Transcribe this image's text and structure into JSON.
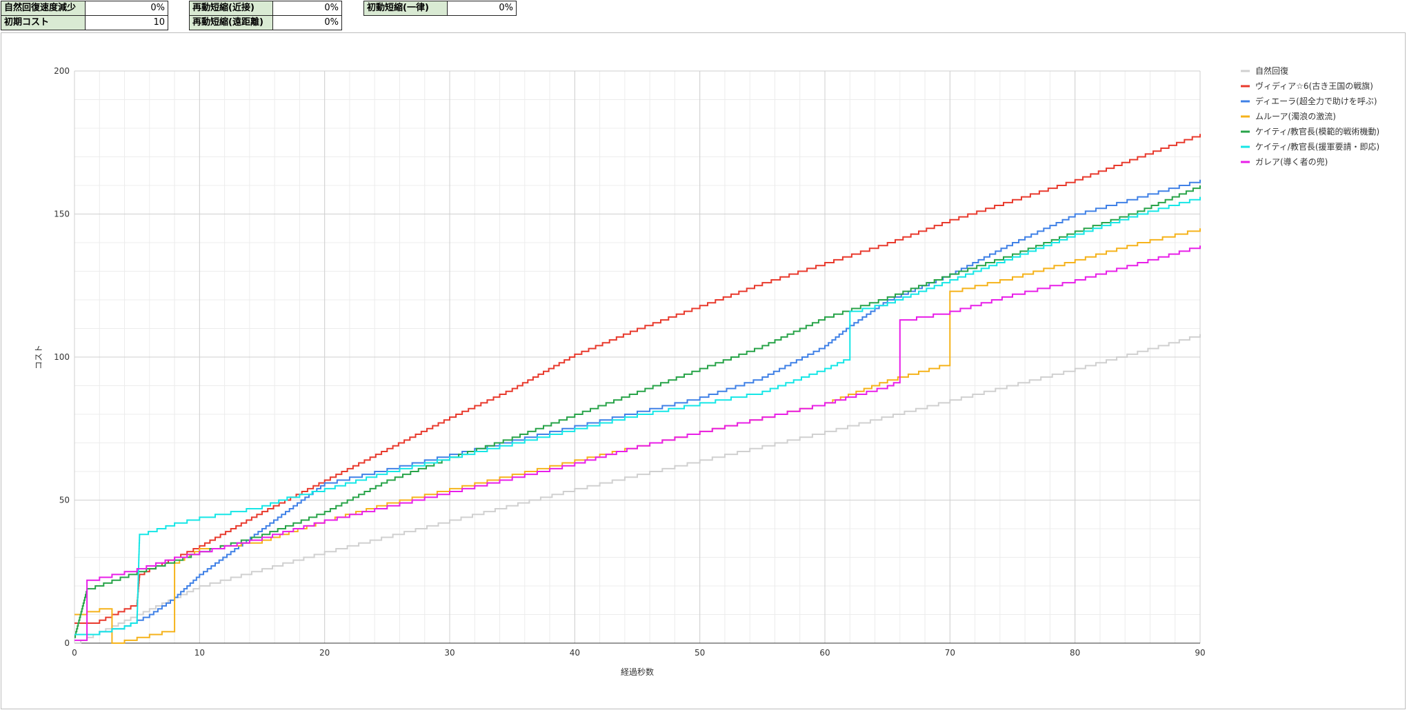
{
  "settings": {
    "regen_decrease_label": "自然回復速度減少",
    "regen_decrease_value": "0%",
    "initial_cost_label": "初期コスト",
    "initial_cost_value": "10",
    "redeploy_melee_label": "再動短縮(近接)",
    "redeploy_melee_value": "0%",
    "redeploy_ranged_label": "再動短縮(遠距離)",
    "redeploy_ranged_value": "0%",
    "initial_uniform_label": "初動短縮(一律)",
    "initial_uniform_value": "0%"
  },
  "chart_data": {
    "type": "line",
    "title": "",
    "xlabel": "経過秒数",
    "ylabel": "コスト",
    "xlim": [
      0,
      90
    ],
    "ylim": [
      0,
      200
    ],
    "xticks": [
      "0",
      "10",
      "20",
      "30",
      "40",
      "50",
      "60",
      "70",
      "80",
      "90"
    ],
    "yticks": [
      "0",
      "50",
      "100",
      "150",
      "200"
    ],
    "grid": true,
    "legend_position": "right",
    "series": [
      {
        "name": "自然回復",
        "color": "#d0d0d0",
        "points": [
          [
            0,
            0
          ],
          [
            10,
            20
          ],
          [
            20,
            32
          ],
          [
            30,
            43
          ],
          [
            40,
            54
          ],
          [
            50,
            64
          ],
          [
            60,
            74
          ],
          [
            70,
            85
          ],
          [
            80,
            96
          ],
          [
            90,
            108
          ]
        ]
      },
      {
        "name": "ヴィディア☆6(古き王国の戦旗)",
        "color": "#e8392c",
        "points": [
          [
            0,
            7
          ],
          [
            2,
            8
          ],
          [
            3,
            10
          ],
          [
            4,
            12
          ],
          [
            5,
            14
          ],
          [
            5.2,
            24
          ],
          [
            6,
            26
          ],
          [
            8,
            30
          ],
          [
            10,
            34
          ],
          [
            15,
            46
          ],
          [
            20,
            57
          ],
          [
            25,
            68
          ],
          [
            30,
            79
          ],
          [
            35,
            89
          ],
          [
            40,
            101
          ],
          [
            45,
            110
          ],
          [
            50,
            118
          ],
          [
            55,
            126
          ],
          [
            60,
            133
          ],
          [
            65,
            140
          ],
          [
            70,
            148
          ],
          [
            75,
            155
          ],
          [
            80,
            162
          ],
          [
            85,
            170
          ],
          [
            90,
            178
          ]
        ]
      },
      {
        "name": "ディエーラ(超全力で助けを呼ぶ)",
        "color": "#3f80e6",
        "points": [
          [
            0,
            3
          ],
          [
            2,
            4
          ],
          [
            4,
            6
          ],
          [
            6,
            10
          ],
          [
            8,
            16
          ],
          [
            10,
            24
          ],
          [
            15,
            40
          ],
          [
            20,
            56
          ],
          [
            25,
            61
          ],
          [
            30,
            66
          ],
          [
            35,
            71
          ],
          [
            40,
            76
          ],
          [
            45,
            81
          ],
          [
            50,
            86
          ],
          [
            55,
            93
          ],
          [
            60,
            104
          ],
          [
            62,
            111
          ],
          [
            65,
            120
          ],
          [
            70,
            129
          ],
          [
            75,
            140
          ],
          [
            80,
            150
          ],
          [
            85,
            156
          ],
          [
            90,
            162
          ]
        ]
      },
      {
        "name": "ムルーア(濁浪の激流)",
        "color": "#f5b21a",
        "points": [
          [
            0,
            10
          ],
          [
            2,
            12
          ],
          [
            3,
            12
          ],
          [
            3,
            0
          ],
          [
            4,
            1
          ],
          [
            6,
            3
          ],
          [
            8,
            5
          ],
          [
            8,
            28
          ],
          [
            10,
            33
          ],
          [
            15,
            36
          ],
          [
            20,
            43
          ],
          [
            25,
            49
          ],
          [
            30,
            54
          ],
          [
            35,
            59
          ],
          [
            40,
            64
          ],
          [
            45,
            69
          ],
          [
            50,
            74
          ],
          [
            55,
            79
          ],
          [
            60,
            84
          ],
          [
            65,
            92
          ],
          [
            70,
            98
          ],
          [
            70,
            123
          ],
          [
            75,
            128
          ],
          [
            80,
            134
          ],
          [
            85,
            140
          ],
          [
            90,
            145
          ]
        ]
      },
      {
        "name": "ケイティ/教官長(模範的戦術機動)",
        "color": "#27a348",
        "points": [
          [
            0,
            2
          ],
          [
            1,
            19
          ],
          [
            3,
            22
          ],
          [
            5,
            25
          ],
          [
            8,
            29
          ],
          [
            10,
            32
          ],
          [
            15,
            38
          ],
          [
            20,
            46
          ],
          [
            25,
            57
          ],
          [
            30,
            65
          ],
          [
            35,
            72
          ],
          [
            40,
            80
          ],
          [
            45,
            88
          ],
          [
            50,
            96
          ],
          [
            55,
            104
          ],
          [
            60,
            114
          ],
          [
            65,
            121
          ],
          [
            70,
            129
          ],
          [
            75,
            136
          ],
          [
            80,
            144
          ],
          [
            85,
            151
          ],
          [
            90,
            160
          ]
        ]
      },
      {
        "name": "ケイティ/教官長(援軍要請・即応)",
        "color": "#15e6e6",
        "points": [
          [
            0,
            3
          ],
          [
            2,
            4
          ],
          [
            4,
            6
          ],
          [
            5,
            8
          ],
          [
            5.2,
            38
          ],
          [
            8,
            42
          ],
          [
            10,
            44
          ],
          [
            15,
            48
          ],
          [
            17,
            51
          ],
          [
            20,
            54
          ],
          [
            25,
            60
          ],
          [
            30,
            65
          ],
          [
            35,
            70
          ],
          [
            40,
            75
          ],
          [
            45,
            80
          ],
          [
            50,
            84
          ],
          [
            55,
            88
          ],
          [
            60,
            96
          ],
          [
            62,
            100
          ],
          [
            62,
            116
          ],
          [
            65,
            119
          ],
          [
            70,
            127
          ],
          [
            75,
            135
          ],
          [
            80,
            143
          ],
          [
            85,
            150
          ],
          [
            90,
            156
          ]
        ]
      },
      {
        "name": "ガレア(導く者の兜)",
        "color": "#e81ee8",
        "points": [
          [
            0,
            1
          ],
          [
            1,
            1
          ],
          [
            1,
            22
          ],
          [
            3,
            24
          ],
          [
            5,
            26
          ],
          [
            8,
            30
          ],
          [
            10,
            32
          ],
          [
            15,
            37
          ],
          [
            20,
            43
          ],
          [
            25,
            48
          ],
          [
            30,
            53
          ],
          [
            35,
            58
          ],
          [
            40,
            63
          ],
          [
            45,
            69
          ],
          [
            50,
            74
          ],
          [
            55,
            79
          ],
          [
            60,
            84
          ],
          [
            65,
            90
          ],
          [
            66,
            92
          ],
          [
            66,
            113
          ],
          [
            70,
            116
          ],
          [
            75,
            122
          ],
          [
            80,
            127
          ],
          [
            85,
            133
          ],
          [
            90,
            139
          ]
        ]
      }
    ]
  }
}
